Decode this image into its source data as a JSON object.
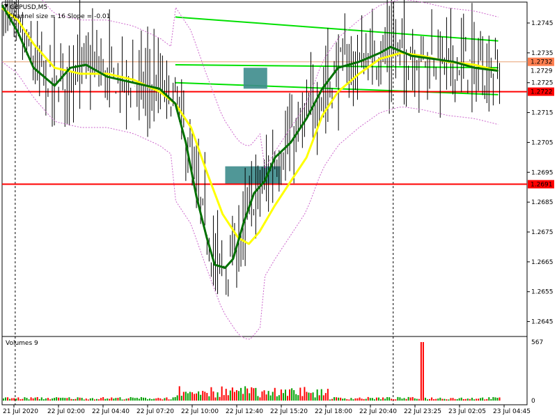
{
  "chart_data": {
    "type": "candlestick",
    "header": {
      "symbol_timeframe": "GBPUSD,M5",
      "indicator_label": "Channel size = 16 Slope = -0.01"
    },
    "volume_panel": {
      "label": "Volumes 9",
      "y_ticks": [
        "567",
        "0"
      ],
      "max": 567
    },
    "price_axis": {
      "ymin": 1.264,
      "ymax": 1.2752,
      "ticks": [
        "1.2745",
        "1.2735",
        "1.2725",
        "1.2715",
        "1.2705",
        "1.2695",
        "1.2685",
        "1.2675",
        "1.2665",
        "1.2655",
        "1.2645"
      ]
    },
    "time_axis": {
      "labels": [
        "21 Jul 2020",
        "22 Jul 02:00",
        "22 Jul 04:40",
        "22 Jul 07:20",
        "22 Jul 10:00",
        "22 Jul 12:40",
        "22 Jul 15:20",
        "22 Jul 18:00",
        "22 Jul 20:40",
        "22 Jul 23:25",
        "23 Jul 02:05",
        "23 Jul 04:45"
      ]
    },
    "horizontal_levels": [
      {
        "price": 1.2722,
        "label": "1.2722",
        "color": "#ff0000"
      },
      {
        "price": 1.2691,
        "label": "1.2691",
        "color": "#ff0000"
      },
      {
        "price": 1.2732,
        "label": "1.2732",
        "color": "#e8a070"
      }
    ],
    "current_price": {
      "price": 1.2729,
      "label": "1.2729"
    },
    "channel": {
      "upper": [
        [
          0.33,
          1.2747
        ],
        [
          0.945,
          1.2739
        ]
      ],
      "middle": [
        [
          0.33,
          1.2731
        ],
        [
          0.945,
          1.273
        ]
      ],
      "lower": [
        [
          0.33,
          1.2725
        ],
        [
          0.945,
          1.2721
        ]
      ],
      "color": "#00e000"
    },
    "series": [
      {
        "color": "#ffff00",
        "points": [
          [
            0,
            1.275
          ],
          [
            0.03,
            1.2746
          ],
          [
            0.06,
            1.2738
          ],
          [
            0.1,
            1.273
          ],
          [
            0.15,
            1.2728
          ],
          [
            0.2,
            1.2728
          ],
          [
            0.25,
            1.2726
          ],
          [
            0.3,
            1.2722
          ],
          [
            0.33,
            1.2718
          ],
          [
            0.36,
            1.271
          ],
          [
            0.39,
            1.2695
          ],
          [
            0.42,
            1.2681
          ],
          [
            0.45,
            1.2673
          ],
          [
            0.47,
            1.2671
          ],
          [
            0.49,
            1.2675
          ],
          [
            0.52,
            1.2684
          ],
          [
            0.55,
            1.2692
          ],
          [
            0.58,
            1.27
          ],
          [
            0.61,
            1.2714
          ],
          [
            0.64,
            1.2722
          ],
          [
            0.68,
            1.2728
          ],
          [
            0.72,
            1.2733
          ],
          [
            0.76,
            1.2735
          ],
          [
            0.8,
            1.2734
          ],
          [
            0.85,
            1.2732
          ],
          [
            0.9,
            1.2731
          ],
          [
            0.945,
            1.2729
          ]
        ]
      },
      {
        "color": "#007000",
        "points": [
          [
            0,
            1.2751
          ],
          [
            0.03,
            1.2742
          ],
          [
            0.06,
            1.273
          ],
          [
            0.1,
            1.2724
          ],
          [
            0.13,
            1.273
          ],
          [
            0.16,
            1.2731
          ],
          [
            0.2,
            1.2727
          ],
          [
            0.25,
            1.2725
          ],
          [
            0.3,
            1.2723
          ],
          [
            0.33,
            1.2718
          ],
          [
            0.35,
            1.2705
          ],
          [
            0.37,
            1.2687
          ],
          [
            0.39,
            1.2673
          ],
          [
            0.405,
            1.2664
          ],
          [
            0.425,
            1.2663
          ],
          [
            0.44,
            1.2666
          ],
          [
            0.46,
            1.2678
          ],
          [
            0.48,
            1.2688
          ],
          [
            0.5,
            1.2692
          ],
          [
            0.52,
            1.27
          ],
          [
            0.55,
            1.2705
          ],
          [
            0.58,
            1.2713
          ],
          [
            0.61,
            1.2723
          ],
          [
            0.64,
            1.273
          ],
          [
            0.68,
            1.2732
          ],
          [
            0.72,
            1.2735
          ],
          [
            0.74,
            1.2737
          ],
          [
            0.78,
            1.2734
          ],
          [
            0.82,
            1.2733
          ],
          [
            0.86,
            1.2732
          ],
          [
            0.9,
            1.273
          ],
          [
            0.945,
            1.2729
          ]
        ]
      }
    ],
    "envelope_color": "#cc66cc",
    "trade_boxes": [
      {
        "x0": 0.46,
        "x1": 0.505,
        "y0": 1.273,
        "y1": 1.2723,
        "color": "#3d8c8c"
      },
      {
        "x0": 0.425,
        "x1": 0.53,
        "y0": 1.2697,
        "y1": 1.2691,
        "color": "#3d8c8c"
      }
    ],
    "session_separators": [
      0.025,
      0.745
    ]
  }
}
